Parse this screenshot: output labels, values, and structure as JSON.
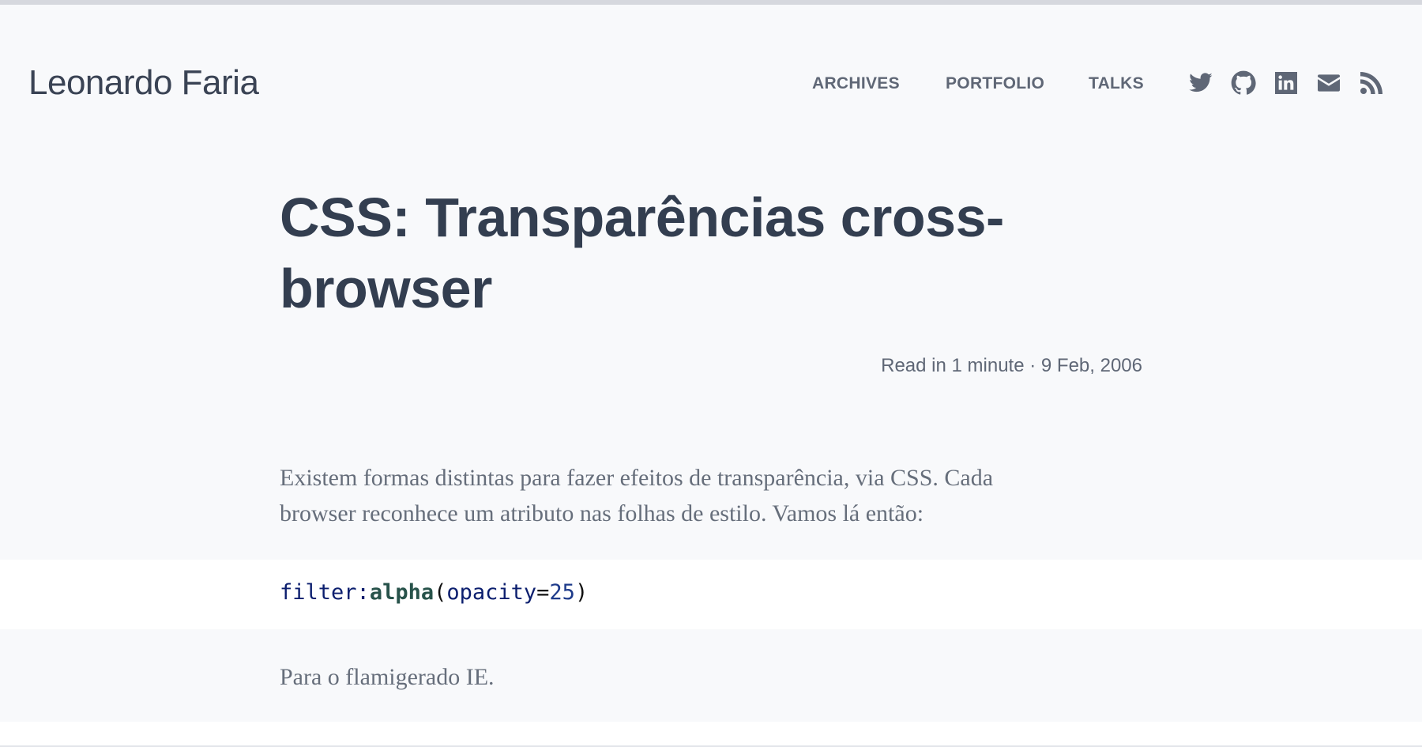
{
  "header": {
    "site_title": "Leonardo Faria",
    "nav": [
      {
        "label": "ARCHIVES"
      },
      {
        "label": "PORTFOLIO"
      },
      {
        "label": "TALKS"
      }
    ],
    "social_icons": [
      "twitter-icon",
      "github-icon",
      "linkedin-icon",
      "mail-icon",
      "rss-icon"
    ]
  },
  "post": {
    "title": "CSS: Transparências cross-browser",
    "meta": "Read in 1 minute · 9 Feb, 2006",
    "paragraph1": "Existem formas distintas para fazer efeitos de transparência, via CSS. Cada browser reconhece um atributo nas folhas de estilo. Vamos lá então:",
    "code": {
      "property": "filter",
      "colon": ":",
      "function": "alpha",
      "open_paren": "(",
      "attribute": "opacity",
      "equals": "=",
      "value": "25",
      "close_paren": ")"
    },
    "paragraph2": "Para o flamigerado IE."
  },
  "colors": {
    "page_background": "#f8f9fb",
    "code_background": "#ffffff",
    "title_text": "#333e50",
    "muted_text": "#5f6776",
    "body_text": "#666e7b"
  }
}
